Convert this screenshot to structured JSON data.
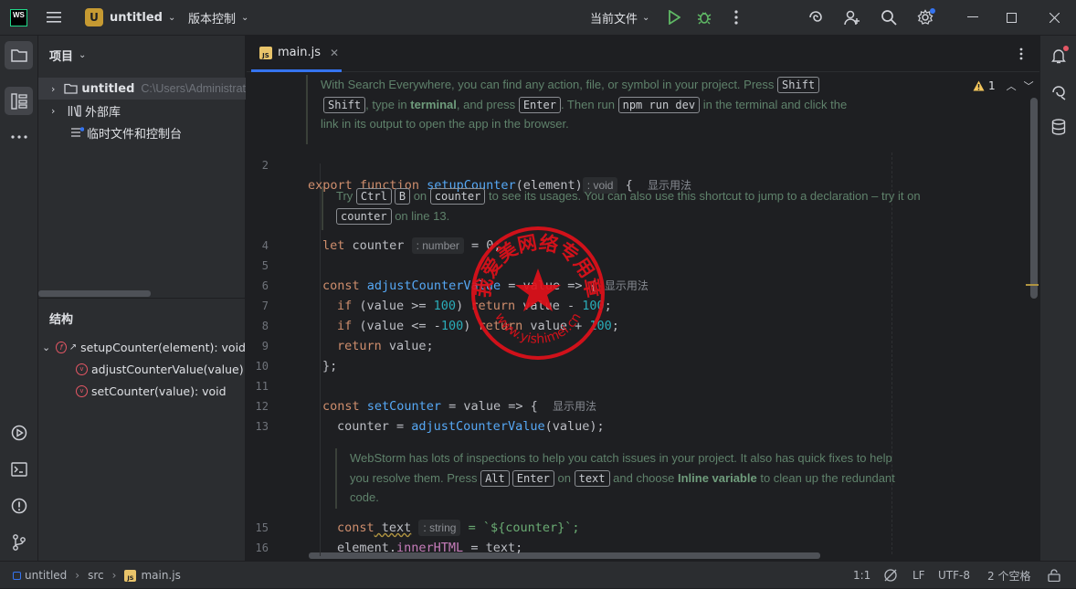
{
  "titlebar": {
    "logo": "WS",
    "project_badge": "U",
    "project_name": "untitled",
    "vcs": "版本控制",
    "run_config": "当前文件"
  },
  "project_panel": {
    "title": "项目",
    "tree": [
      {
        "label": "untitled",
        "path": "C:\\Users\\Administrat"
      },
      {
        "label": "外部库"
      },
      {
        "label": "临时文件和控制台"
      }
    ]
  },
  "structure_panel": {
    "title": "结构",
    "items": [
      {
        "label": "setupCounter(element): void"
      },
      {
        "label": "adjustCounterValue(value)"
      },
      {
        "label": "setCounter(value): void"
      }
    ]
  },
  "editor": {
    "tab_label": "main.js",
    "tab_badge": "JS",
    "warning_count": "1",
    "doc1": {
      "t1": "With Search Everywhere, you can find any action, file, or symbol in your project. Press",
      "k1": "Shift",
      "k2": "Shift",
      "t2": ", type in",
      "b1": "terminal",
      "t3": ", and press",
      "k3": "Enter",
      "t4": ". Then run",
      "k4": "npm run dev",
      "t5": "in the terminal and click the link in its output to open the app in the browser."
    },
    "doc2": {
      "t1": "Try",
      "k1": "Ctrl",
      "k2": "B",
      "t2": "on",
      "k3": "counter",
      "t3": "to see its usages. You can also use this shortcut to jump to a declaration – try it on",
      "k4": "counter",
      "t4": "on line 13."
    },
    "doc3": {
      "t1": "WebStorm has lots of inspections to help you catch issues in your project. It also has quick fixes to help you resolve them. Press",
      "k1": "Alt",
      "k2": "Enter",
      "t2": "on",
      "k3": "text",
      "t3": "and choose",
      "b1": "Inline variable",
      "t4": "to clean up the redundant code."
    },
    "line_numbers": [
      "2",
      "4",
      "5",
      "6",
      "7",
      "8",
      "9",
      "10",
      "11",
      "12",
      "13",
      "15",
      "16"
    ],
    "code": {
      "l2": {
        "kw1": "export",
        "kw2": "function",
        "fn": "setupCounter",
        "rest": "(element)",
        "hint": ": void",
        "brace": " {",
        "usage": "显示用法"
      },
      "l4": {
        "kw": "let",
        "id": " counter",
        "hint": ": number",
        "rest": " = 0;"
      },
      "l6": {
        "kw": "const",
        "fn": " adjustCounterValue",
        "rest": " = value => {",
        "usage": "显示用法"
      },
      "l7": {
        "kw1": "if",
        "a": " (value >= ",
        "n1": "100",
        "b": ") ",
        "kw2": "return",
        "c": " value - ",
        "n2": "100",
        "d": ";"
      },
      "l8": {
        "kw1": "if",
        "a": " (value <= -",
        "n1": "100",
        "b": ") ",
        "kw2": "return",
        "c": " value + ",
        "n2": "100",
        "d": ";"
      },
      "l9": {
        "kw": "return",
        "rest": " value;"
      },
      "l10": {
        "rest": "};"
      },
      "l12": {
        "kw": "const",
        "fn": " setCounter",
        "rest": " = value => {",
        "usage": "显示用法"
      },
      "l13": {
        "a": "counter = ",
        "fn": "adjustCounterValue",
        "b": "(value);"
      },
      "l15": {
        "kw": "const",
        "id": " text",
        "hint": ": string",
        "rest": " = `${counter}`;"
      },
      "l16": {
        "a": "element.",
        "fld": "innerHTML",
        "b": " = text;"
      }
    }
  },
  "stamp": {
    "text": "我爱美网络专用章",
    "url": "www.yishimei.cn",
    "color": "#e0101a"
  },
  "statusbar": {
    "crumbs": [
      "untitled",
      "src",
      "main.js"
    ],
    "position": "1:1",
    "line_sep": "LF",
    "encoding": "UTF-8",
    "indent": "2 个空格"
  },
  "colors": {
    "accent": "#3574f0",
    "warning": "#f2c55c",
    "run": "#5fb865"
  }
}
